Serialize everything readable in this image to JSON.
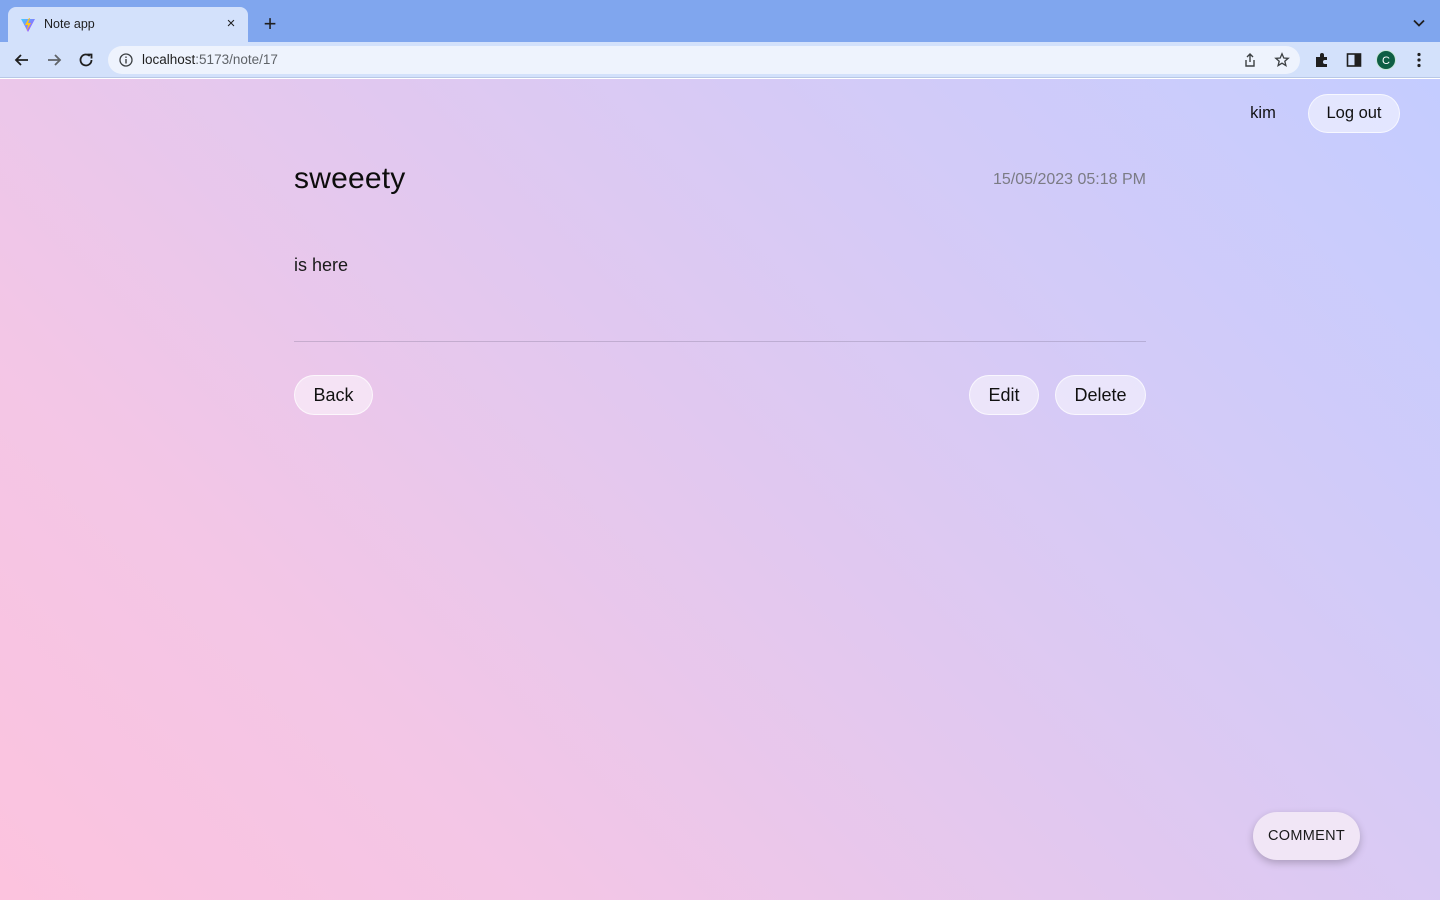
{
  "browser": {
    "tab_title": "Note app",
    "tab_close": "×",
    "new_tab": "+",
    "url_host": "localhost",
    "url_rest": ":5173/note/17",
    "profile_initial": "C"
  },
  "header": {
    "username": "kim",
    "logout_label": "Log out"
  },
  "note": {
    "title": "sweeety",
    "date": "15/05/2023 05:18 PM",
    "body": "is here"
  },
  "actions": {
    "back_label": "Back",
    "edit_label": "Edit",
    "delete_label": "Delete"
  },
  "comment_label": "COMMENT",
  "colors": {
    "tabstrip": "#80a6ee",
    "toolbar": "#d3e1fb",
    "gradient_start": "#fcc3de",
    "gradient_end": "#c4ccff",
    "avatar": "#0e5e44"
  }
}
